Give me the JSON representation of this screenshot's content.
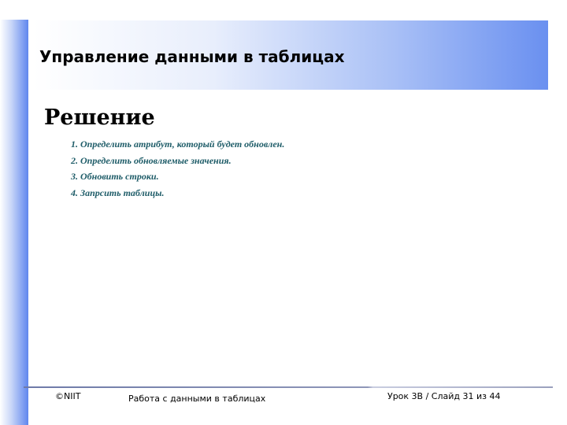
{
  "slide": {
    "title": "Управление данными в таблицах",
    "section_heading": "Решение",
    "steps": [
      "1. Определить атрибут, который будет обновлен.",
      "2. Определить обновляемые значения.",
      "3. Обновить строки.",
      "4. Запрсить таблицы."
    ]
  },
  "footer": {
    "copyright": "©NIIT",
    "course": "Работа с данными в таблицах",
    "slide_number": "Урок 3B / Слайд 31 из 44"
  },
  "colors": {
    "accent_blue": "#5f86ee",
    "steps_text": "#1e5c68"
  }
}
